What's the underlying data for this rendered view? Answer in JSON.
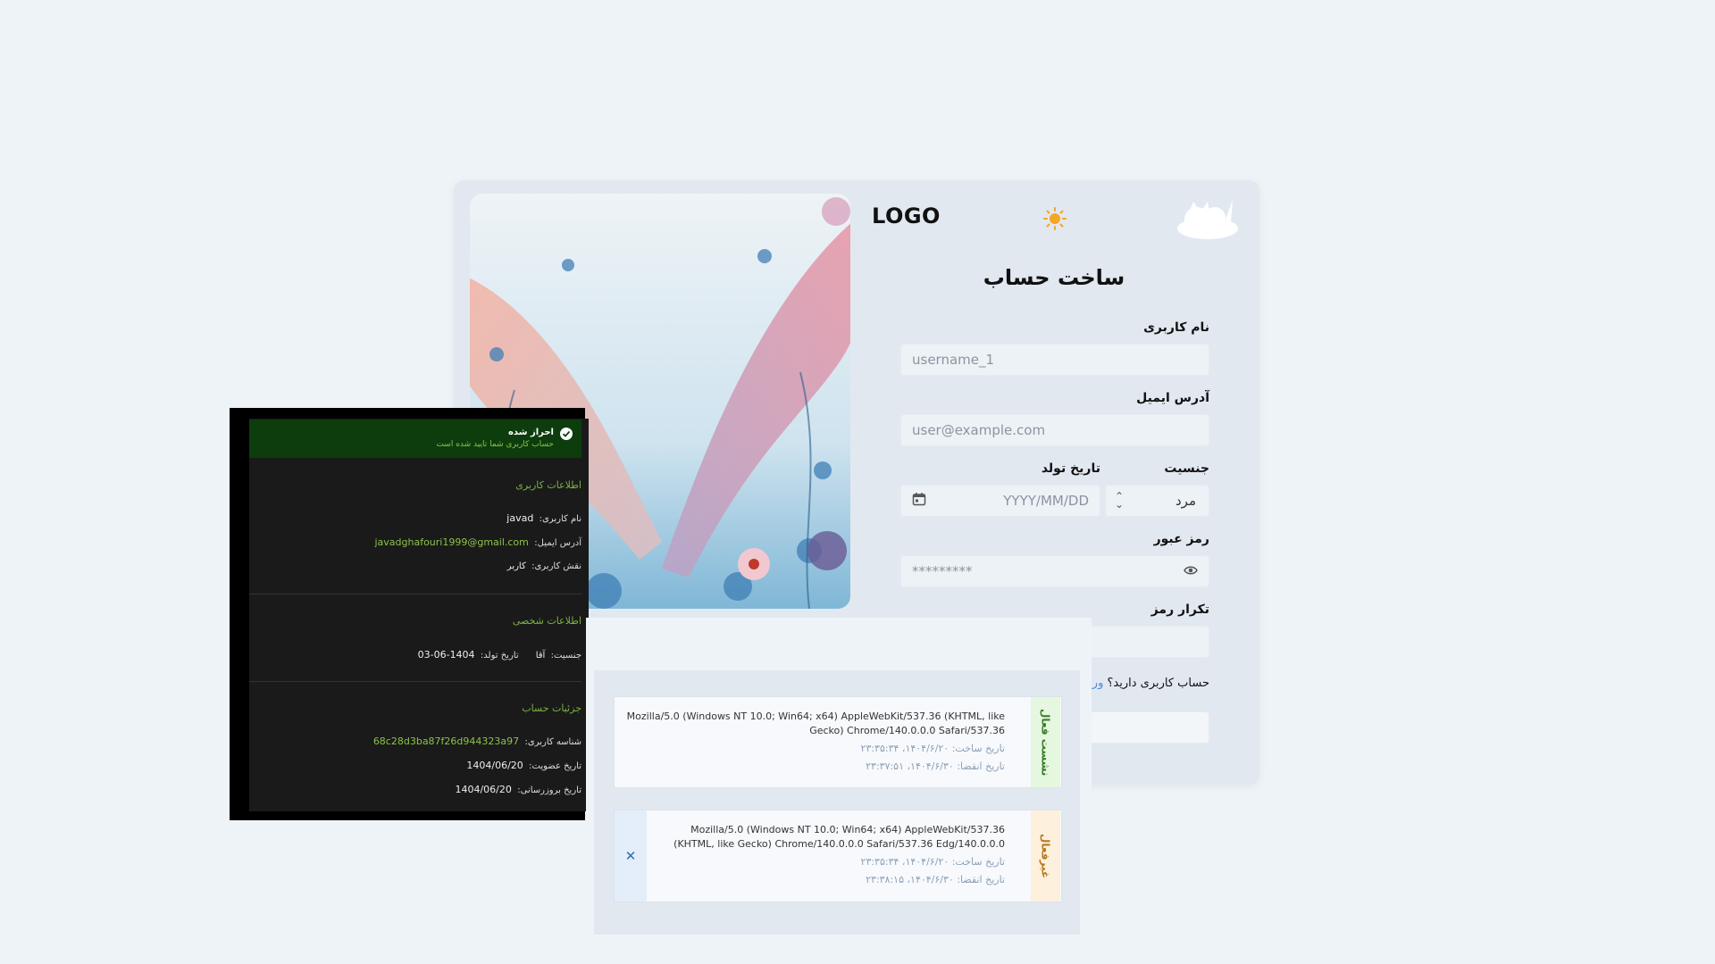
{
  "header": {
    "logo": "LOGO",
    "theme_icon": "sun-icon",
    "brand_icon": "cat-cloud-icon"
  },
  "form": {
    "title": "ساخت حساب",
    "username": {
      "label": "نام کاربری",
      "placeholder": "username_1"
    },
    "email": {
      "label": "آدرس ایمیل",
      "placeholder": "user@example.com"
    },
    "gender": {
      "label": "جنسیت",
      "value": "مرد"
    },
    "birthdate": {
      "label": "تاریخ تولد",
      "placeholder": "YYYY/MM/DD"
    },
    "password": {
      "label": "رمز عبور",
      "value": "*********"
    },
    "confirm_password": {
      "label": "تکرار رمز"
    },
    "login_prompt": "حساب کاربری دارید؟",
    "login_link": "ورود"
  },
  "profile": {
    "verified_title": "احراز شده",
    "verified_desc": "حساب کاربری شما تایید شده است",
    "user_info": {
      "heading": "اطلاعات کاربری",
      "username_label": "نام کاربری:",
      "username": "javad",
      "email_label": "آدرس ایمیل:",
      "email": "javadghafouri1999@gmail.com",
      "role_label": "نقش کاربری:",
      "role": "کاربر"
    },
    "personal_info": {
      "heading": "اطلاعات شخصی",
      "gender_label": "جنسیت:",
      "gender": "آقا",
      "birth_label": "تاریخ تولد:",
      "birth": "1404-06-03"
    },
    "account_details": {
      "heading": "جزئیات حساب",
      "id_label": "شناسه کاربری:",
      "id": "68c28d3ba87f26d944323a97",
      "member_label": "تاریخ عضویت:",
      "member": "1404/06/20",
      "updated_label": "تاریخ بروزرسانی:",
      "updated": "1404/06/20"
    }
  },
  "sessions": [
    {
      "status": "نشست فعال",
      "user_agent": "Mozilla/5.0 (Windows NT 10.0; Win64; x64) AppleWebKit/537.36 (KHTML, like Gecko) Chrome/140.0.0.0 Safari/537.36",
      "created": "تاریخ ساخت: ۱۴۰۴/۶/۲۰، ۲۳:۳۵:۳۴",
      "expires": "تاریخ انقضا: ۱۴۰۴/۶/۳۰، ۲۳:۳۷:۵۱"
    },
    {
      "status": "غیرفعال",
      "user_agent": "Mozilla/5.0 (Windows NT 10.0; Win64; x64) AppleWebKit/537.36 (KHTML, like Gecko) Chrome/140.0.0.0 Safari/537.36 Edg/140.0.0.0",
      "created": "تاریخ ساخت: ۱۴۰۴/۶/۲۰، ۲۳:۳۵:۳۴",
      "expires": "تاریخ انقضا: ۱۴۰۴/۶/۳۰، ۲۳:۳۸:۱۵",
      "close_icon": "close-icon"
    }
  ],
  "colors": {
    "active_tag": "#e5f7df",
    "inactive_tag": "#fdf0dd",
    "link": "#4a89dc",
    "verified_bg": "#0d3d0d",
    "accent_green": "#8bc34a"
  }
}
